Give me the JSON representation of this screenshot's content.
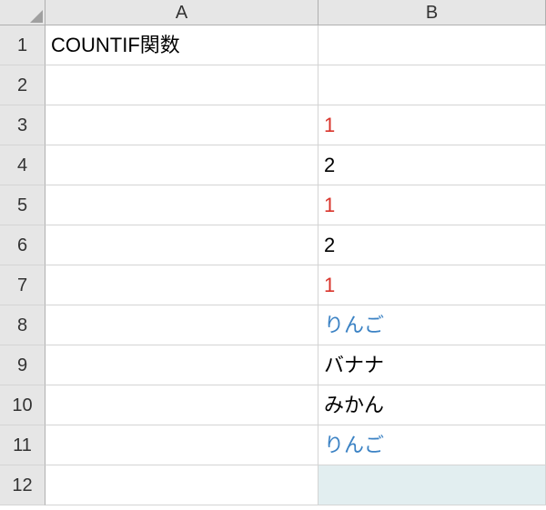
{
  "columns": [
    "A",
    "B"
  ],
  "rows": [
    "1",
    "2",
    "3",
    "4",
    "5",
    "6",
    "7",
    "8",
    "9",
    "10",
    "11",
    "12"
  ],
  "cells": {
    "A1": {
      "value": "COUNTIF関数",
      "color": ""
    },
    "B1": {
      "value": "",
      "color": ""
    },
    "A2": {
      "value": "",
      "color": ""
    },
    "B2": {
      "value": "",
      "color": ""
    },
    "A3": {
      "value": "",
      "color": ""
    },
    "B3": {
      "value": "1",
      "color": "red"
    },
    "A4": {
      "value": "",
      "color": ""
    },
    "B4": {
      "value": "2",
      "color": ""
    },
    "A5": {
      "value": "",
      "color": ""
    },
    "B5": {
      "value": "1",
      "color": "red"
    },
    "A6": {
      "value": "",
      "color": ""
    },
    "B6": {
      "value": "2",
      "color": ""
    },
    "A7": {
      "value": "",
      "color": ""
    },
    "B7": {
      "value": "1",
      "color": "red"
    },
    "A8": {
      "value": "",
      "color": ""
    },
    "B8": {
      "value": "りんご",
      "color": "blue"
    },
    "A9": {
      "value": "",
      "color": ""
    },
    "B9": {
      "value": "バナナ",
      "color": ""
    },
    "A10": {
      "value": "",
      "color": ""
    },
    "B10": {
      "value": "みかん",
      "color": ""
    },
    "A11": {
      "value": "",
      "color": ""
    },
    "B11": {
      "value": "りんご",
      "color": "blue"
    },
    "A12": {
      "value": "",
      "color": ""
    },
    "B12": {
      "value": "",
      "color": "",
      "selected": true
    }
  }
}
